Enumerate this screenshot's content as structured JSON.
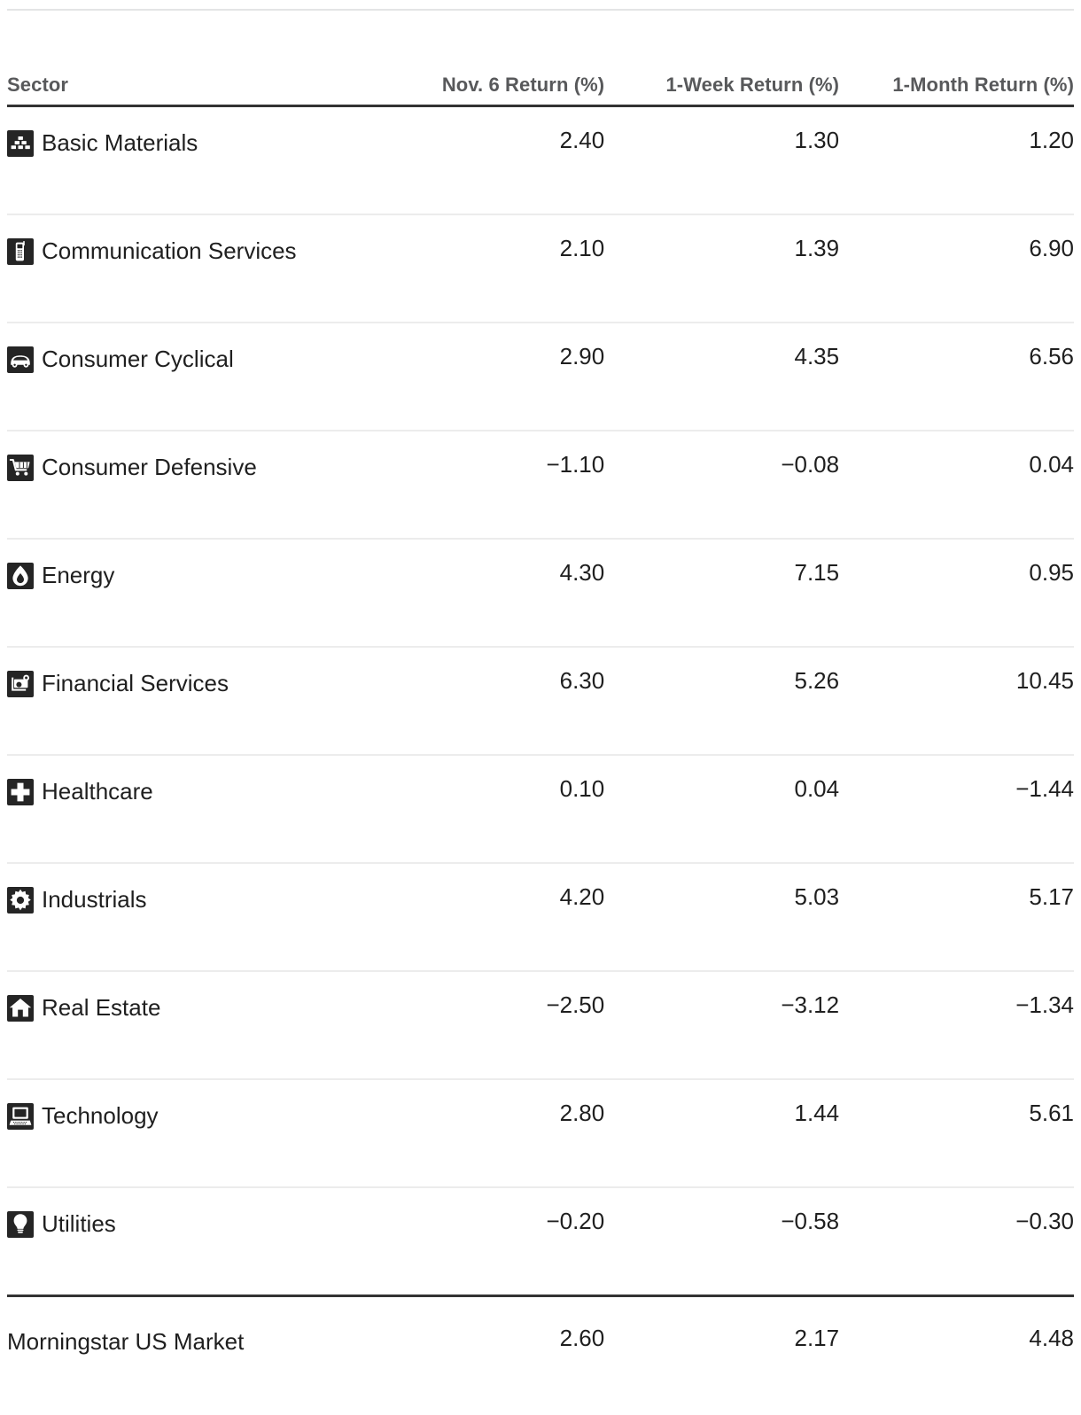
{
  "table": {
    "columns": [
      {
        "key": "sector",
        "label": "Sector",
        "align": "left"
      },
      {
        "key": "daily",
        "label": "Nov. 6 Return (%)",
        "align": "right"
      },
      {
        "key": "week",
        "label": "1-Week Return (%)",
        "align": "right"
      },
      {
        "key": "month",
        "label": "1-Month Return (%)",
        "align": "right"
      }
    ],
    "rows": [
      {
        "icon": "bricks-icon",
        "sector": "Basic Materials",
        "daily": "2.40",
        "week": "1.30",
        "month": "1.20"
      },
      {
        "icon": "mobile-phone-icon",
        "sector": "Communication Services",
        "daily": "2.10",
        "week": "1.39",
        "month": "6.90"
      },
      {
        "icon": "car-icon",
        "sector": "Consumer Cyclical",
        "daily": "2.90",
        "week": "4.35",
        "month": "6.56"
      },
      {
        "icon": "shopping-cart-icon",
        "sector": "Consumer Defensive",
        "daily": "−1.10",
        "week": "−0.08",
        "month": "0.04"
      },
      {
        "icon": "flame-drop-icon",
        "sector": "Energy",
        "daily": "4.30",
        "week": "7.15",
        "month": "0.95"
      },
      {
        "icon": "money-icon",
        "sector": "Financial Services",
        "daily": "6.30",
        "week": "5.26",
        "month": "10.45"
      },
      {
        "icon": "medical-cross-icon",
        "sector": "Healthcare",
        "daily": "0.10",
        "week": "0.04",
        "month": "−1.44"
      },
      {
        "icon": "gear-icon",
        "sector": "Industrials",
        "daily": "4.20",
        "week": "5.03",
        "month": "5.17"
      },
      {
        "icon": "house-icon",
        "sector": "Real Estate",
        "daily": "−2.50",
        "week": "−3.12",
        "month": "−1.34"
      },
      {
        "icon": "computer-icon",
        "sector": "Technology",
        "daily": "2.80",
        "week": "1.44",
        "month": "5.61"
      },
      {
        "icon": "lightbulb-icon",
        "sector": "Utilities",
        "daily": "−0.20",
        "week": "−0.58",
        "month": "−0.30"
      }
    ],
    "footer": {
      "icon": null,
      "sector": "Morningstar US Market",
      "daily": "2.60",
      "week": "2.17",
      "month": "4.48"
    }
  },
  "style": {
    "text_color": "#1f1f1f",
    "header_text_color": "#58595b",
    "icon_background": "#252525",
    "icon_glyph_color": "#ffffff",
    "rule_dark": "#333333",
    "rule_light": "#ececec",
    "rule_top": "#e3e4e5",
    "background": "#ffffff"
  }
}
